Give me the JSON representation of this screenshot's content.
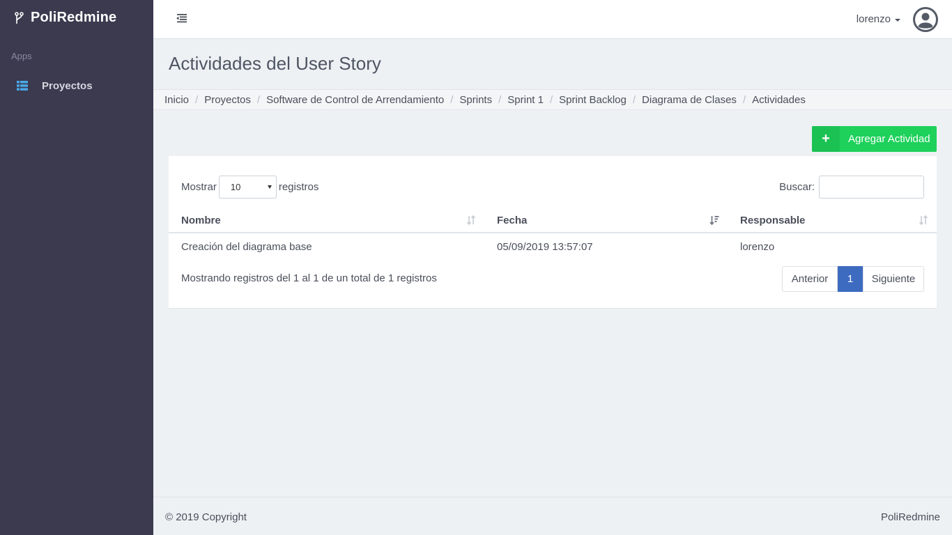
{
  "brand": {
    "name": "PoliRedmine",
    "icon": "branch-icon"
  },
  "sidebar": {
    "section": "Apps",
    "items": [
      {
        "label": "Proyectos",
        "icon": "list-icon"
      }
    ]
  },
  "topbar": {
    "username": "lorenzo"
  },
  "page": {
    "title": "Actividades del User Story"
  },
  "breadcrumb": [
    "Inicio",
    "Proyectos",
    "Software de Control de Arrendamiento",
    "Sprints",
    "Sprint 1",
    "Sprint Backlog",
    "Diagrama de Clases",
    "Actividades"
  ],
  "actions": {
    "add_label": "Agregar Actividad",
    "add_icon": "+"
  },
  "table_controls": {
    "show_prefix": "Mostrar",
    "show_value": "10",
    "show_suffix": "registros",
    "search_label": "Buscar:",
    "search_value": ""
  },
  "table": {
    "columns": [
      "Nombre",
      "Fecha",
      "Responsable"
    ],
    "rows": [
      [
        "Creación del diagrama base",
        "05/09/2019 13:57:07",
        "lorenzo"
      ]
    ]
  },
  "pagination": {
    "info": "Mostrando registros del 1 al 1 de un total de 1 registros",
    "prev": "Anterior",
    "current": "1",
    "next": "Siguiente"
  },
  "footer": {
    "left": "© 2019 Copyright",
    "right": "PoliRedmine"
  },
  "colors": {
    "sidebar": "#3b3a4f",
    "add_button": "#1ed15b",
    "active_page": "#3d6bc0"
  }
}
